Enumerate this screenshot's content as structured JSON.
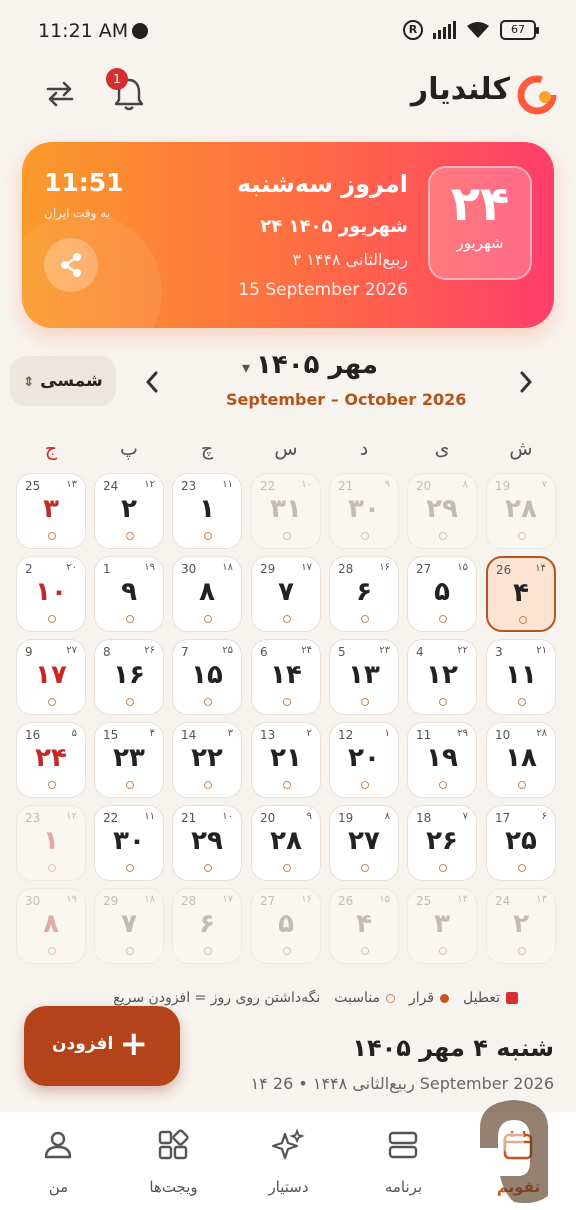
{
  "status": {
    "time": "11:21 AM",
    "battery": "67"
  },
  "header": {
    "title": "کلندیار",
    "notif_count": "1"
  },
  "today": {
    "day_num": "۲۴",
    "day_month": "شهریور",
    "title": "امروز سه‌شنبه",
    "shamsi": "۲۴ شهریور ۱۴۰۵",
    "hijri": "۳ ربیع‌الثانی ۱۴۴۸",
    "gregorian": "15 September 2026",
    "clock": "11:51",
    "tz": "به وقت ایران"
  },
  "month": {
    "type_label": "شمسی",
    "title": "مهر ۱۴۰۵",
    "sub": "September – October 2026"
  },
  "weekdays": [
    "ش",
    "ی",
    "د",
    "س",
    "چ",
    "پ",
    "ج"
  ],
  "weeks": [
    [
      {
        "p": "۲۸",
        "g": "19",
        "h": "۷",
        "f": true
      },
      {
        "p": "۲۹",
        "g": "20",
        "h": "۸",
        "f": true
      },
      {
        "p": "۳۰",
        "g": "21",
        "h": "۹",
        "f": true
      },
      {
        "p": "۳۱",
        "g": "22",
        "h": "۱۰",
        "f": true
      },
      {
        "p": "۱",
        "g": "23",
        "h": "۱۱"
      },
      {
        "p": "۲",
        "g": "24",
        "h": "۱۲"
      },
      {
        "p": "۳",
        "g": "25",
        "h": "۱۳",
        "r": true
      }
    ],
    [
      {
        "p": "۴",
        "g": "26",
        "h": "۱۴",
        "t": true
      },
      {
        "p": "۵",
        "g": "27",
        "h": "۱۵"
      },
      {
        "p": "۶",
        "g": "28",
        "h": "۱۶"
      },
      {
        "p": "۷",
        "g": "29",
        "h": "۱۷"
      },
      {
        "p": "۸",
        "g": "30",
        "h": "۱۸"
      },
      {
        "p": "۹",
        "g": "1",
        "h": "۱۹"
      },
      {
        "p": "۱۰",
        "g": "2",
        "h": "۲۰",
        "r": true
      }
    ],
    [
      {
        "p": "۱۱",
        "g": "3",
        "h": "۲۱"
      },
      {
        "p": "۱۲",
        "g": "4",
        "h": "۲۲"
      },
      {
        "p": "۱۳",
        "g": "5",
        "h": "۲۳"
      },
      {
        "p": "۱۴",
        "g": "6",
        "h": "۲۴"
      },
      {
        "p": "۱۵",
        "g": "7",
        "h": "۲۵"
      },
      {
        "p": "۱۶",
        "g": "8",
        "h": "۲۶"
      },
      {
        "p": "۱۷",
        "g": "9",
        "h": "۲۷",
        "r": true
      }
    ],
    [
      {
        "p": "۱۸",
        "g": "10",
        "h": "۲۸"
      },
      {
        "p": "۱۹",
        "g": "11",
        "h": "۲۹"
      },
      {
        "p": "۲۰",
        "g": "12",
        "h": "۱"
      },
      {
        "p": "۲۱",
        "g": "13",
        "h": "۲"
      },
      {
        "p": "۲۲",
        "g": "14",
        "h": "۳"
      },
      {
        "p": "۲۳",
        "g": "15",
        "h": "۴"
      },
      {
        "p": "۲۴",
        "g": "16",
        "h": "۵",
        "r": true
      }
    ],
    [
      {
        "p": "۲۵",
        "g": "17",
        "h": "۶"
      },
      {
        "p": "۲۶",
        "g": "18",
        "h": "۷"
      },
      {
        "p": "۲۷",
        "g": "19",
        "h": "۸"
      },
      {
        "p": "۲۸",
        "g": "20",
        "h": "۹"
      },
      {
        "p": "۲۹",
        "g": "21",
        "h": "۱۰"
      },
      {
        "p": "۳۰",
        "g": "22",
        "h": "۱۱"
      },
      {
        "p": "۱",
        "g": "23",
        "h": "۱۲",
        "f": true,
        "r": true
      }
    ],
    [
      {
        "p": "۲",
        "g": "24",
        "h": "۱۳",
        "f": true
      },
      {
        "p": "۳",
        "g": "25",
        "h": "۱۴",
        "f": true
      },
      {
        "p": "۴",
        "g": "26",
        "h": "۱۵",
        "f": true
      },
      {
        "p": "۵",
        "g": "27",
        "h": "۱۶",
        "f": true
      },
      {
        "p": "۶",
        "g": "28",
        "h": "۱۷",
        "f": true
      },
      {
        "p": "۷",
        "g": "29",
        "h": "۱۸",
        "f": true
      },
      {
        "p": "۸",
        "g": "30",
        "h": "۱۹",
        "f": true,
        "r": true
      }
    ]
  ],
  "legend": {
    "holiday": "تعطیل",
    "event": "قرار",
    "occasion": "مناسبت",
    "hint": "نگه‌داشتن روی روز = افزودن سریع"
  },
  "fab": {
    "label": "افزودن"
  },
  "selected": {
    "title": "شنبه ۴ مهر ۱۴۰۵",
    "sub": "۱۴ ربیع‌الثانی ۱۴۴۸ • 26 September 2026"
  },
  "nav": {
    "calendar": "تقویم",
    "program": "برنامه",
    "assistant": "دستیار",
    "widgets": "ویجت‌ها",
    "me": "من"
  },
  "colors": {
    "accent": "#c4551f",
    "holiday": "#c62828"
  }
}
